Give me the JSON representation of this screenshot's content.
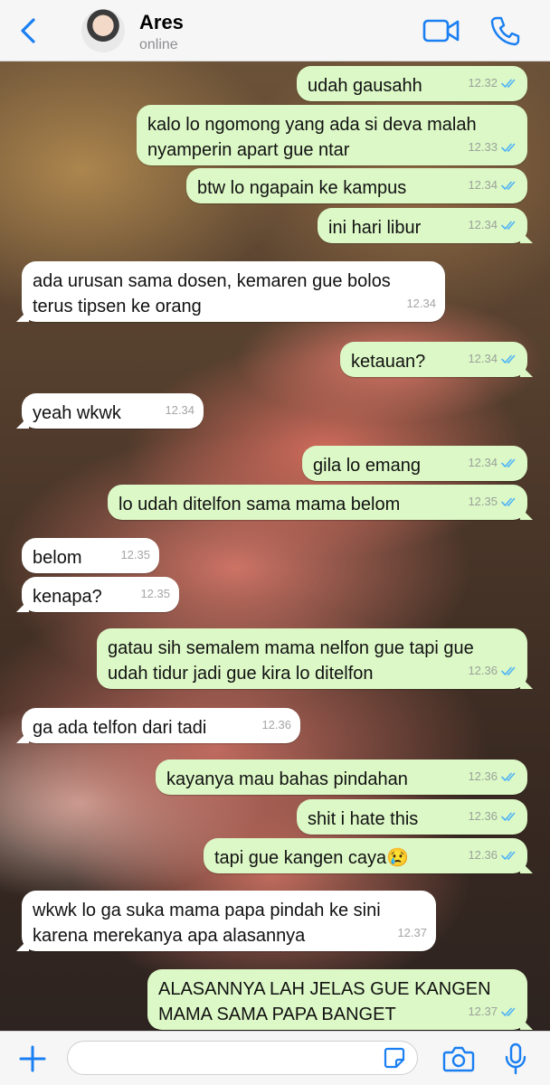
{
  "header": {
    "title": "Ares",
    "status": "online"
  },
  "colors": {
    "accent": "#1a7ff2",
    "outgoing_bubble": "#dcf8c6",
    "incoming_bubble": "#ffffff",
    "read_ticks": "#4fb3f6"
  },
  "icons": {
    "back": "chevron-left-icon",
    "video": "video-camera-icon",
    "call": "phone-icon",
    "attach": "plus-icon",
    "sticker": "sticker-icon",
    "camera": "camera-icon",
    "mic": "microphone-icon"
  },
  "messages": [
    {
      "dir": "out",
      "text": "udah gausahh",
      "time": "12.32"
    },
    {
      "dir": "out",
      "text": "kalo lo ngomong yang ada si deva malah nyamperin apart gue ntar",
      "time": "12.33"
    },
    {
      "dir": "out",
      "text": "btw lo ngapain ke kampus",
      "time": "12.34"
    },
    {
      "dir": "out",
      "text": "ini hari libur",
      "time": "12.34"
    },
    {
      "dir": "in",
      "text": "ada urusan sama dosen, kemaren gue bolos terus tipsen ke orang",
      "time": "12.34"
    },
    {
      "dir": "out",
      "text": "ketauan?",
      "time": "12.34"
    },
    {
      "dir": "in",
      "text": "yeah wkwk",
      "time": "12.34"
    },
    {
      "dir": "out",
      "text": "gila lo emang",
      "time": "12.34"
    },
    {
      "dir": "out",
      "text": "lo udah ditelfon sama mama belom",
      "time": "12.35"
    },
    {
      "dir": "in",
      "text": "belom",
      "time": "12.35"
    },
    {
      "dir": "in",
      "text": "kenapa?",
      "time": "12.35"
    },
    {
      "dir": "out",
      "text": "gatau sih semalem mama nelfon gue tapi gue udah tidur jadi gue kira lo ditelfon",
      "time": "12.36"
    },
    {
      "dir": "in",
      "text": "ga ada telfon dari tadi",
      "time": "12.36"
    },
    {
      "dir": "out",
      "text": "kayanya mau bahas pindahan",
      "time": "12.36"
    },
    {
      "dir": "out",
      "text": "shit i hate this",
      "time": "12.36"
    },
    {
      "dir": "out",
      "text": "tapi gue kangen caya😢",
      "time": "12.36"
    },
    {
      "dir": "in",
      "text": "wkwk lo ga suka mama papa pindah ke sini karena merekanya apa alasannya",
      "time": "12.37"
    },
    {
      "dir": "out",
      "text": "ALASANNYA LAH JELAS GUE KANGEN MAMA SAMA PAPA BANGET",
      "time": "12.37"
    }
  ],
  "composer": {
    "value": "",
    "placeholder": ""
  }
}
